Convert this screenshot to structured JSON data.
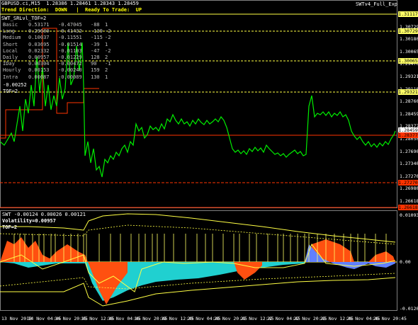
{
  "header": {
    "symbol_line": "GBPUSD.ci,M15  1.28386 1.28461 1.28343 1.28459",
    "trend_line": "Trend Direction:  DOWN   |  Ready To Trade:  UP",
    "indicator_name": "SWT_SRLvl_TOF=2",
    "top_right": "SWTv4_Full_Exp"
  },
  "stats_rows": [
    {
      "name": "Basic",
      "a": "0.53171",
      "b": "-0.47045",
      "c": "-88",
      "d": "1"
    },
    {
      "name": "Long",
      "a": "0.29680",
      "b": "-0.41432",
      "c": "-139",
      "d": "-2"
    },
    {
      "name": "Medium",
      "a": "0.10037",
      "b": "-0.11551",
      "c": "-115",
      "d": "-2"
    },
    {
      "name": "Short",
      "a": "0.03695",
      "b": "-0.01514",
      "c": "-39",
      "d": "1"
    },
    {
      "name": "Local",
      "a": "0.02332",
      "b": "-0.01103",
      "c": "-47",
      "d": "-2"
    },
    {
      "name": "Daily",
      "a": "0.00957",
      "b": "-0.01229",
      "c": "128",
      "d": "2"
    },
    {
      "name": "IDay",
      "a": "0.00304",
      "b": "-0.00472",
      "c": "90",
      "d": "-1"
    },
    {
      "name": "Hourly",
      "a": "0.00153",
      "b": "-0.00240",
      "c": "159",
      "d": "2"
    },
    {
      "name": "Intra",
      "a": "0.00087",
      "b": "-0.00089",
      "c": "130",
      "d": "1"
    }
  ],
  "extra_lines": [
    "-0.00252",
    "TOF=2"
  ],
  "price_axis": [
    "1.31117",
    "1.30729",
    "1.30180",
    "1.30065",
    "1.29470",
    "1.29321",
    "1.29110",
    "1.28760",
    "1.28459",
    "1.28377",
    "1.28050",
    "1.27690",
    "1.27340",
    "1.27270",
    "1.26980",
    "1.26618"
  ],
  "price_badges": [
    {
      "label": "1.31117",
      "color": "#ffff66"
    },
    {
      "label": "1.30729",
      "color": "#ffff66"
    },
    {
      "label": "1.30065",
      "color": "#ffff66"
    },
    {
      "label": "1.29321",
      "color": "#ffff66"
    },
    {
      "label": "1.28459",
      "color": "#ffffff"
    },
    {
      "label": "1.28377",
      "color": "#ff3300"
    },
    {
      "label": "1.27270",
      "color": "#ff3300"
    },
    {
      "label": "1.26618",
      "color": "#ff3300"
    }
  ],
  "sub": {
    "title": "SWT -0.00124 0.00026 0.00121",
    "volatility": "Volatility=0.00957",
    "tof": "TOF=2",
    "axis_top": "0.01093",
    "axis_mid": "0.00",
    "axis_bottom": "-0.01204"
  },
  "time_axis": [
    "13 Nov 2018",
    "14 Nov 04:45",
    "14 Nov 20:45",
    "15 Nov 12:45",
    "16 Nov 04:45",
    "16 Nov 20:45",
    "19 Nov 12:45",
    "20 Nov 04:45",
    "20 Nov 20:45",
    "21 Nov 12:45",
    "22 Nov 04:45",
    "22 Nov 20:45",
    "23 Nov 12:45",
    "26 Nov 04:45",
    "26 Nov 20:45"
  ]
}
